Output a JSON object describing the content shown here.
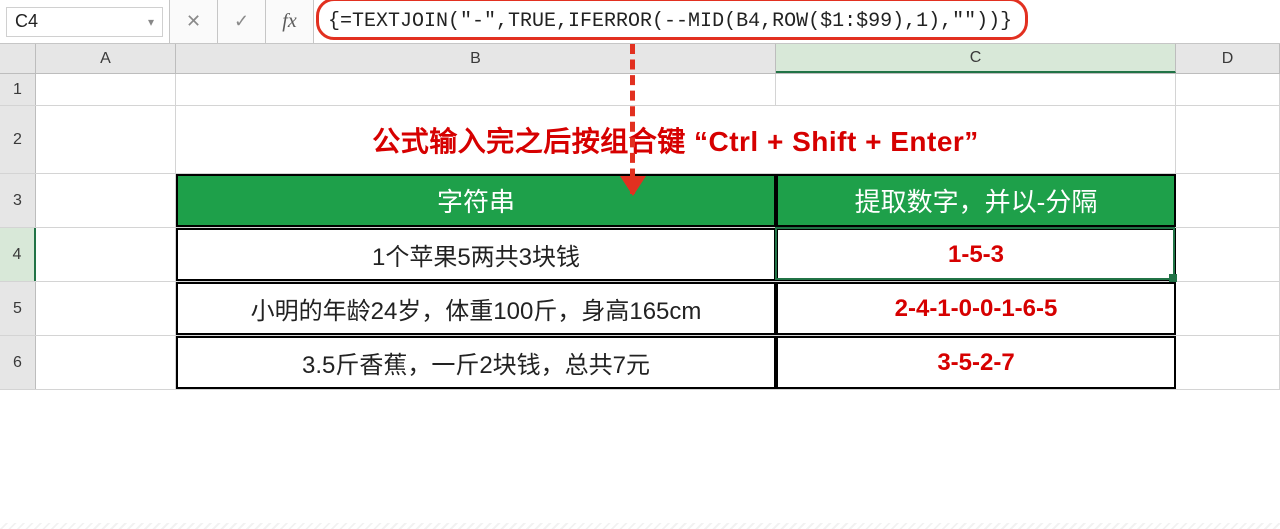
{
  "name_box": {
    "value": "C4"
  },
  "formula_bar": {
    "cancel_tooltip": "Cancel",
    "enter_tooltip": "Enter",
    "fx_tooltip": "Insert Function",
    "formula": "{=TEXTJOIN(\"-\",TRUE,IFERROR(--MID(B4,ROW($1:$99),1),\"\"))}"
  },
  "columns": [
    "A",
    "B",
    "C",
    "D"
  ],
  "row_numbers": [
    "1",
    "2",
    "3",
    "4",
    "5",
    "6"
  ],
  "instruction": "公式输入完之后按组合键 “Ctrl + Shift + Enter”",
  "table": {
    "headers": {
      "string_col": "字符串",
      "result_col": "提取数字，并以-分隔"
    },
    "rows": [
      {
        "string": "1个苹果5两共3块钱",
        "result": "1-5-3"
      },
      {
        "string": "小明的年龄24岁，体重100斤，身高165cm",
        "result": "2-4-1-0-0-1-6-5"
      },
      {
        "string": "3.5斤香蕉，一斤2块钱，总共7元",
        "result": "3-5-2-7"
      }
    ]
  },
  "active_cell": "C4"
}
